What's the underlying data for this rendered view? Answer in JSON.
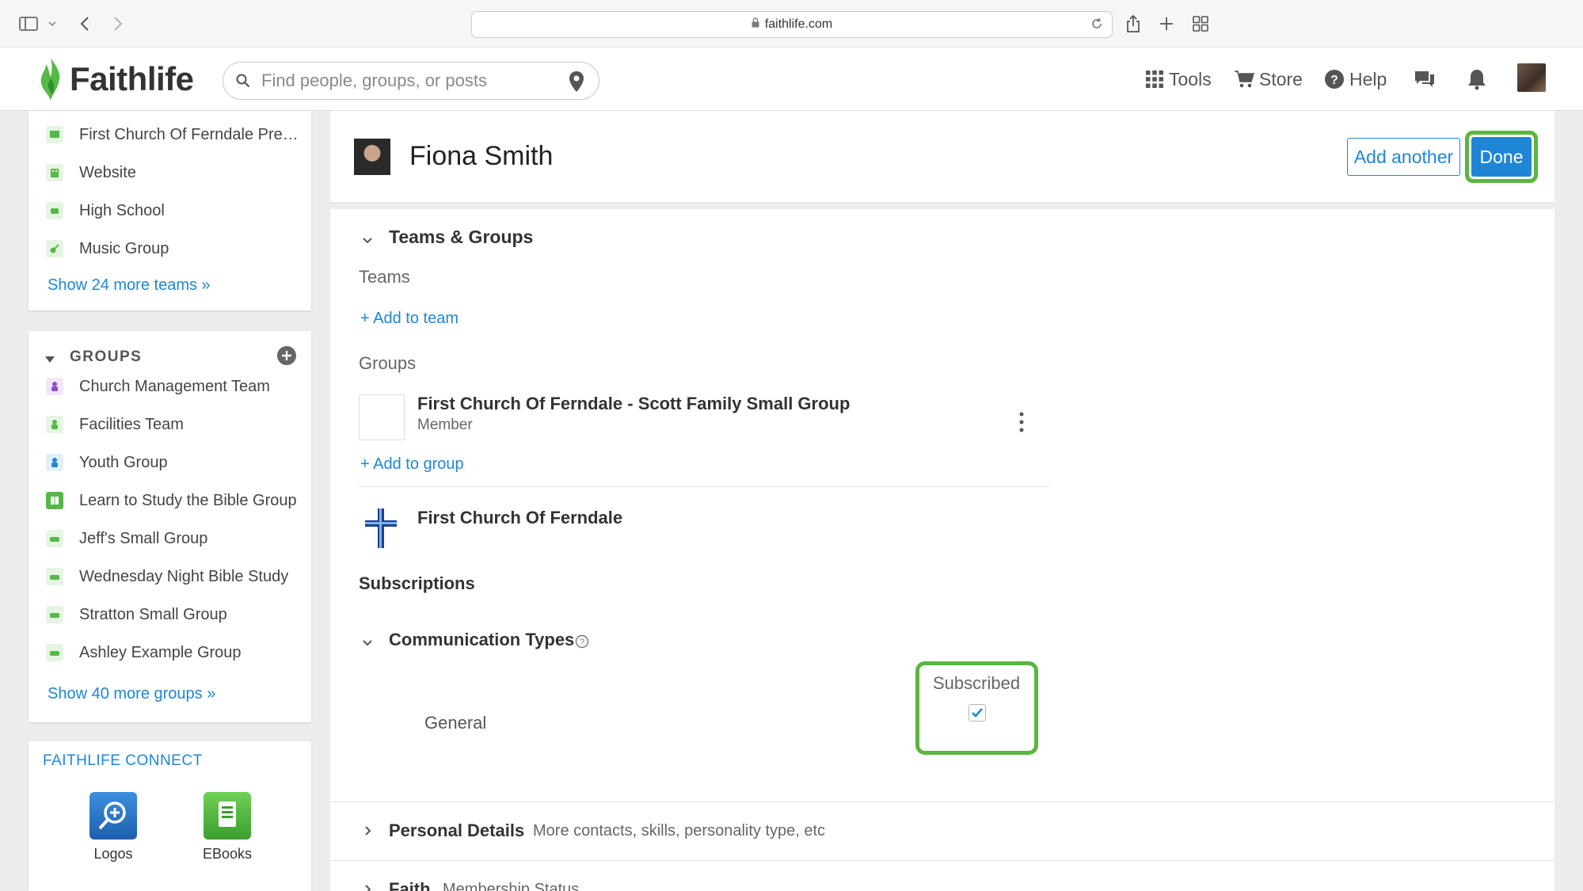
{
  "browser": {
    "url": "faithlife.com"
  },
  "header": {
    "logo_text": "Faithlife",
    "search_placeholder": "Find people, groups, or posts",
    "nav": {
      "tools": "Tools",
      "store": "Store",
      "help": "Help"
    }
  },
  "sidebar": {
    "teams": [
      {
        "label": "First Church Of Ferndale Pre…",
        "color": "#56b947"
      },
      {
        "label": "Website",
        "color": "#56b947"
      },
      {
        "label": "High School",
        "color": "#56b947"
      },
      {
        "label": "Music Group",
        "color": "#56b947"
      }
    ],
    "teams_more": "Show 24 more teams »",
    "groups_title": "GROUPS",
    "groups": [
      {
        "label": "Church Management Team",
        "color": "#8a4fc4"
      },
      {
        "label": "Facilities Team",
        "color": "#56b947"
      },
      {
        "label": "Youth Group",
        "color": "#1f86d6"
      },
      {
        "label": "Learn to Study the Bible Group",
        "color": "#56b947"
      },
      {
        "label": "Jeff's Small Group",
        "color": "#56b947"
      },
      {
        "label": "Wednesday Night Bible Study",
        "color": "#56b947"
      },
      {
        "label": "Stratton Small Group",
        "color": "#56b947"
      },
      {
        "label": "Ashley Example Group",
        "color": "#56b947"
      }
    ],
    "groups_more": "Show 40 more groups »",
    "connect_title": "FAITHLIFE CONNECT",
    "apps": [
      {
        "label": "Logos"
      },
      {
        "label": "EBooks"
      }
    ]
  },
  "profile": {
    "name": "Fiona Smith",
    "add_another": "Add another",
    "done": "Done"
  },
  "teams_groups": {
    "title": "Teams & Groups",
    "teams_label": "Teams",
    "add_team": "+ Add to team",
    "groups_label": "Groups",
    "group_name": "First Church Of Ferndale - Scott Family Small Group",
    "group_role": "Member",
    "add_group": "+ Add to group",
    "org_name": "First Church Of Ferndale"
  },
  "subscriptions": {
    "title": "Subscriptions",
    "comm_title": "Communication Types",
    "column_label": "Subscribed",
    "row_label": "General",
    "checked": true
  },
  "personal": {
    "title": "Personal Details",
    "hint": "More contacts, skills, personality type, etc"
  },
  "faith": {
    "title": "Faith",
    "hint": "Membership Status"
  },
  "colors": {
    "accent": "#1f86d6",
    "highlight": "#5ab63e"
  }
}
